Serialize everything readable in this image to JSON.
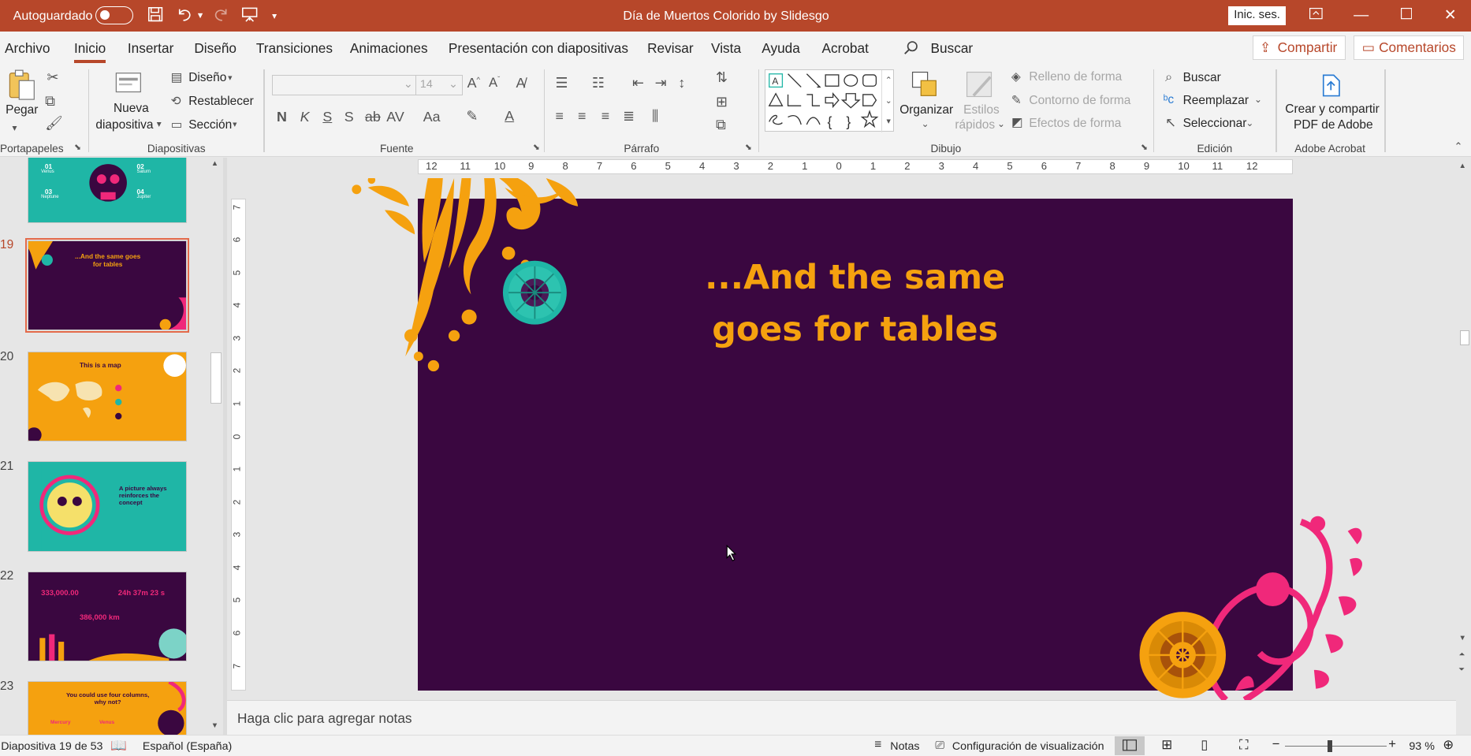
{
  "titlebar": {
    "autosave": "Autoguardado",
    "title": "Día de Muertos Colorido by Slidesgo",
    "signin": "Inic. ses."
  },
  "menu": {
    "tabs": [
      "Archivo",
      "Inicio",
      "Insertar",
      "Diseño",
      "Transiciones",
      "Animaciones",
      "Presentación con diapositivas",
      "Revisar",
      "Vista",
      "Ayuda",
      "Acrobat"
    ],
    "search": "Buscar",
    "share": "Compartir",
    "comments": "Comentarios"
  },
  "ribbon": {
    "clipboard": {
      "paste": "Pegar",
      "group": "Portapapeles"
    },
    "slides": {
      "new_slide_1": "Nueva",
      "new_slide_2": "diapositiva",
      "layout": "Diseño",
      "reset": "Restablecer",
      "section": "Sección",
      "group": "Diapositivas"
    },
    "font": {
      "size": "14",
      "bold": "N",
      "italic": "K",
      "underline": "S",
      "shadow": "S",
      "strike": "ab",
      "spacing": "AV",
      "case": "Aa",
      "group": "Fuente"
    },
    "paragraph": {
      "group": "Párrafo"
    },
    "drawing": {
      "arrange": "Organizar",
      "styles_1": "Estilos",
      "styles_2": "rápidos",
      "fill": "Relleno de forma",
      "outline": "Contorno de forma",
      "effects": "Efectos de forma",
      "group": "Dibujo"
    },
    "editing": {
      "find": "Buscar",
      "replace": "Reemplazar",
      "select": "Seleccionar",
      "group": "Edición"
    },
    "acrobat": {
      "create_1": "Crear y compartir",
      "create_2": "PDF de Adobe",
      "group": "Adobe Acrobat"
    }
  },
  "thumbs": [
    {
      "num": "19",
      "title": "...And the same goes for tables"
    },
    {
      "num": "20",
      "title": "This is a map"
    },
    {
      "num": "21",
      "title": "A picture always reinforces the concept"
    },
    {
      "num": "22",
      "v1": "333,000.00",
      "v2": "24h 37m 23 s",
      "v3": "386,000 km"
    },
    {
      "num": "23",
      "title": "You could use four columns, why not?"
    }
  ],
  "thumb18": {
    "c1": "01",
    "c1b": "Venus",
    "c2": "02",
    "c2b": "Saturn",
    "c3": "03",
    "c3b": "Neptune",
    "c4": "04",
    "c4b": "Jupiter"
  },
  "thumb23cols": [
    "Mercury",
    "Venus"
  ],
  "slide": {
    "title_line1": "...And the same",
    "title_line2": "goes for tables"
  },
  "ruler": {
    "h": [
      "12",
      "11",
      "10",
      "9",
      "8",
      "7",
      "6",
      "5",
      "4",
      "3",
      "2",
      "1",
      "0",
      "1",
      "2",
      "3",
      "4",
      "5",
      "6",
      "7",
      "8",
      "9",
      "10",
      "11",
      "12"
    ],
    "v": [
      "7",
      "6",
      "5",
      "4",
      "3",
      "2",
      "1",
      "0",
      "1",
      "2",
      "3",
      "4",
      "5",
      "6",
      "7"
    ]
  },
  "notes": {
    "placeholder": "Haga clic para agregar notas"
  },
  "status": {
    "slide": "Diapositiva 19 de 53",
    "lang": "Español (España)",
    "notes": "Notas",
    "display": "Configuración de visualización",
    "zoom": "93 %"
  },
  "colors": {
    "accent": "#b7472a",
    "slide_bg": "#3a0740",
    "title": "#f5a10f",
    "orange": "#f5a10f",
    "teal": "#1fb6a6",
    "pink": "#f0287a"
  }
}
